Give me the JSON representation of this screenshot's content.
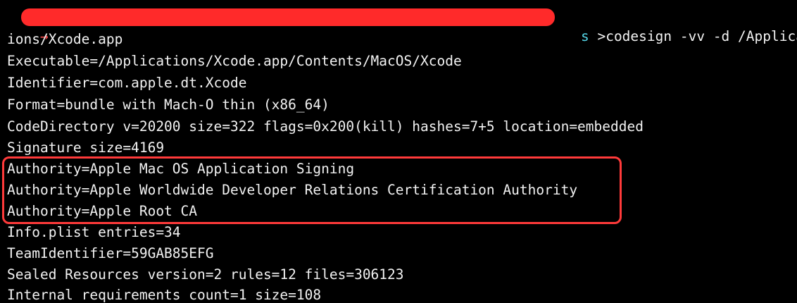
{
  "terminal": {
    "prompt": {
      "arrow": "→",
      "tail": "s",
      "command": " >codesign -vv -d /Applicat"
    },
    "output_lines": [
      "ions/Xcode.app",
      "Executable=/Applications/Xcode.app/Contents/MacOS/Xcode",
      "Identifier=com.apple.dt.Xcode",
      "Format=bundle with Mach-O thin (x86_64)",
      "CodeDirectory v=20200 size=322 flags=0x200(kill) hashes=7+5 location=embedded",
      "Signature size=4169",
      "Authority=Apple Mac OS Application Signing",
      "Authority=Apple Worldwide Developer Relations Certification Authority",
      "Authority=Apple Root CA",
      "Info.plist entries=34",
      "TeamIdentifier=59GAB85EFG",
      "Sealed Resources version=2 rules=12 files=306123",
      "Internal requirements count=1 size=108"
    ]
  },
  "colors": {
    "background": "#000000",
    "text": "#f2f2f2",
    "prompt_arrow": "#ff4e50",
    "prompt_path": "#54d5e6",
    "redaction": "#ff2a2a",
    "highlight_border": "#ff3a3a"
  }
}
